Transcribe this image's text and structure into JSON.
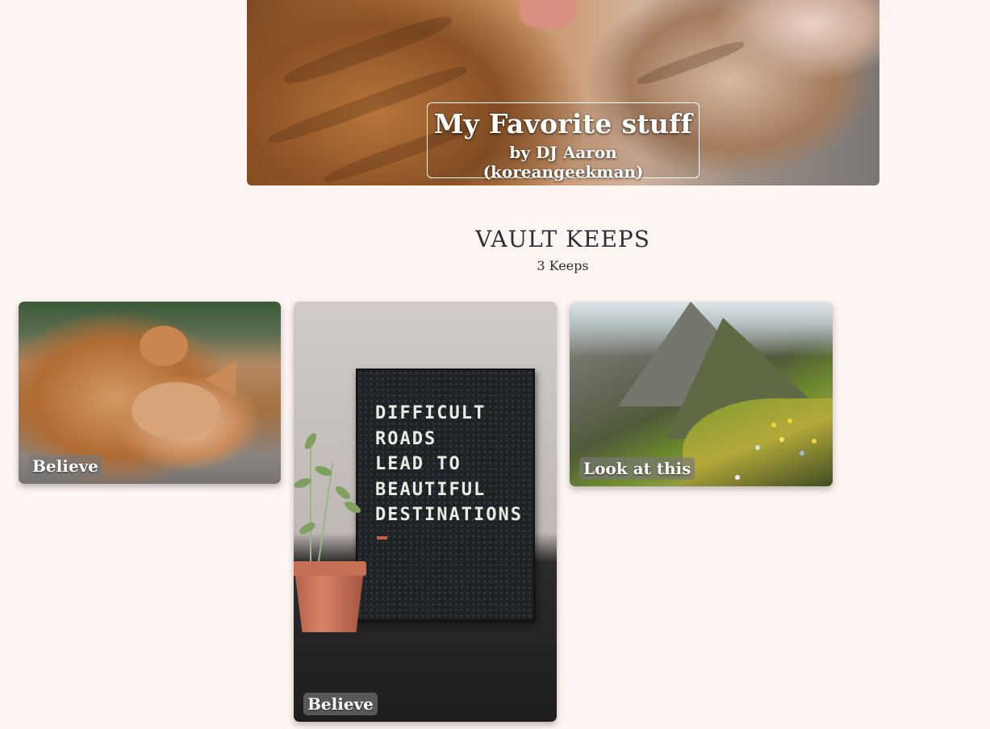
{
  "vault": {
    "title": "My Favorite stuff",
    "byline": "by DJ Aaron (koreangeekman)"
  },
  "keeps_section": {
    "heading": "VAULT KEEPS",
    "count": "3 Keeps"
  },
  "keeps": [
    {
      "name": "Believe",
      "image": "orange-cat-sleeping"
    },
    {
      "name": "Believe",
      "image": "letter-board",
      "board_text": "DIFFICULT\nROADS\nLEAD TO\nBEAUTIFUL\nDESTINATIONS"
    },
    {
      "name": "Look at this",
      "image": "mountain-meadow"
    }
  ]
}
